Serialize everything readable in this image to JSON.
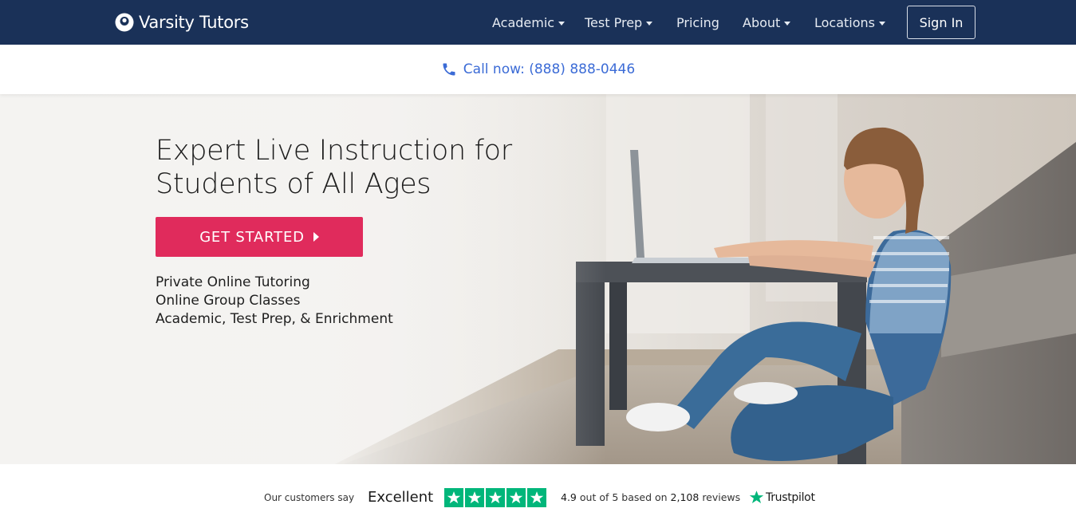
{
  "brand": {
    "name": "Varsity Tutors"
  },
  "nav": {
    "items": [
      {
        "label": "Academic",
        "has_dropdown": true
      },
      {
        "label": "Test Prep",
        "has_dropdown": true
      },
      {
        "label": "Pricing",
        "has_dropdown": false
      },
      {
        "label": "About",
        "has_dropdown": true
      },
      {
        "label": "Locations",
        "has_dropdown": true
      }
    ],
    "signin_label": "Sign In"
  },
  "callbar": {
    "label": "Call now: (888) 888-0446",
    "icon": "phone-icon"
  },
  "hero": {
    "title": "Expert Live Instruction for Students of All Ages",
    "cta_label": "GET STARTED",
    "bullets": [
      "Private Online Tutoring",
      "Online Group Classes",
      "Academic, Test Prep, & Enrichment"
    ]
  },
  "trust": {
    "customers_say": "Our customers say",
    "verdict": "Excellent",
    "stars": 5,
    "score": "4.9",
    "score_suffix": "out of 5 based on",
    "review_count": "2,108",
    "reviews_word": "reviews",
    "brand": "Trustpilot"
  },
  "colors": {
    "nav_bg": "#1a3158",
    "cta": "#e02b5c",
    "call_link": "#3b6bd6",
    "trustpilot_green": "#00b67a"
  }
}
